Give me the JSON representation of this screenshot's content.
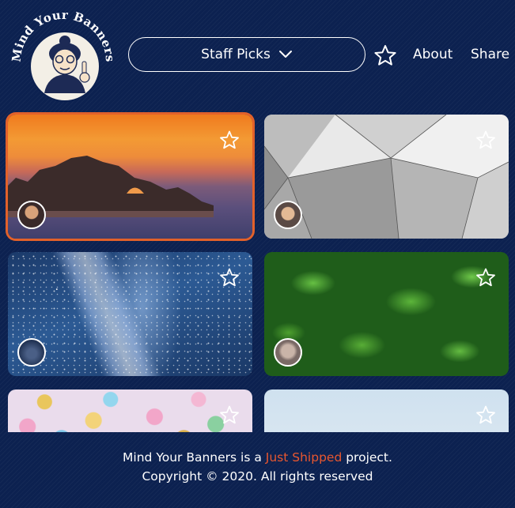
{
  "header": {
    "logo_text": "Mind Your Banners",
    "logo_icon": "grandma-mascot-icon",
    "dropdown": {
      "selected": "Staff Picks",
      "icon": "chevron-down-icon"
    },
    "favorites_icon": "star-outline-icon",
    "nav": [
      {
        "label": "About"
      },
      {
        "label": "Share"
      }
    ]
  },
  "cards": [
    {
      "photo": "sunset-sea-arch",
      "selected": true,
      "favorite_icon": "star-outline-icon",
      "avatar": "user-avatar"
    },
    {
      "photo": "grey-geometric-architecture",
      "selected": false,
      "favorite_icon": "star-outline-icon",
      "avatar": "user-avatar"
    },
    {
      "photo": "milky-way-night-sky",
      "selected": false,
      "favorite_icon": "star-outline-icon",
      "avatar": "user-avatar"
    },
    {
      "photo": "green-leaves-water-drops",
      "selected": false,
      "favorite_icon": "star-outline-icon",
      "avatar": "user-avatar"
    },
    {
      "photo": "colorful-glass-beads",
      "selected": false,
      "favorite_icon": "star-outline-icon"
    },
    {
      "photo": "pale-crystal-sky",
      "selected": false,
      "favorite_icon": "star-outline-icon"
    }
  ],
  "footer": {
    "prefix": "Mind Your Banners is a",
    "link": "Just Shipped",
    "suffix": "project.",
    "copyright": "Copyright © 2020. All rights reserved"
  },
  "colors": {
    "background": "#0c2150",
    "accent": "#e9572f",
    "selected_border": "#e2612a"
  }
}
